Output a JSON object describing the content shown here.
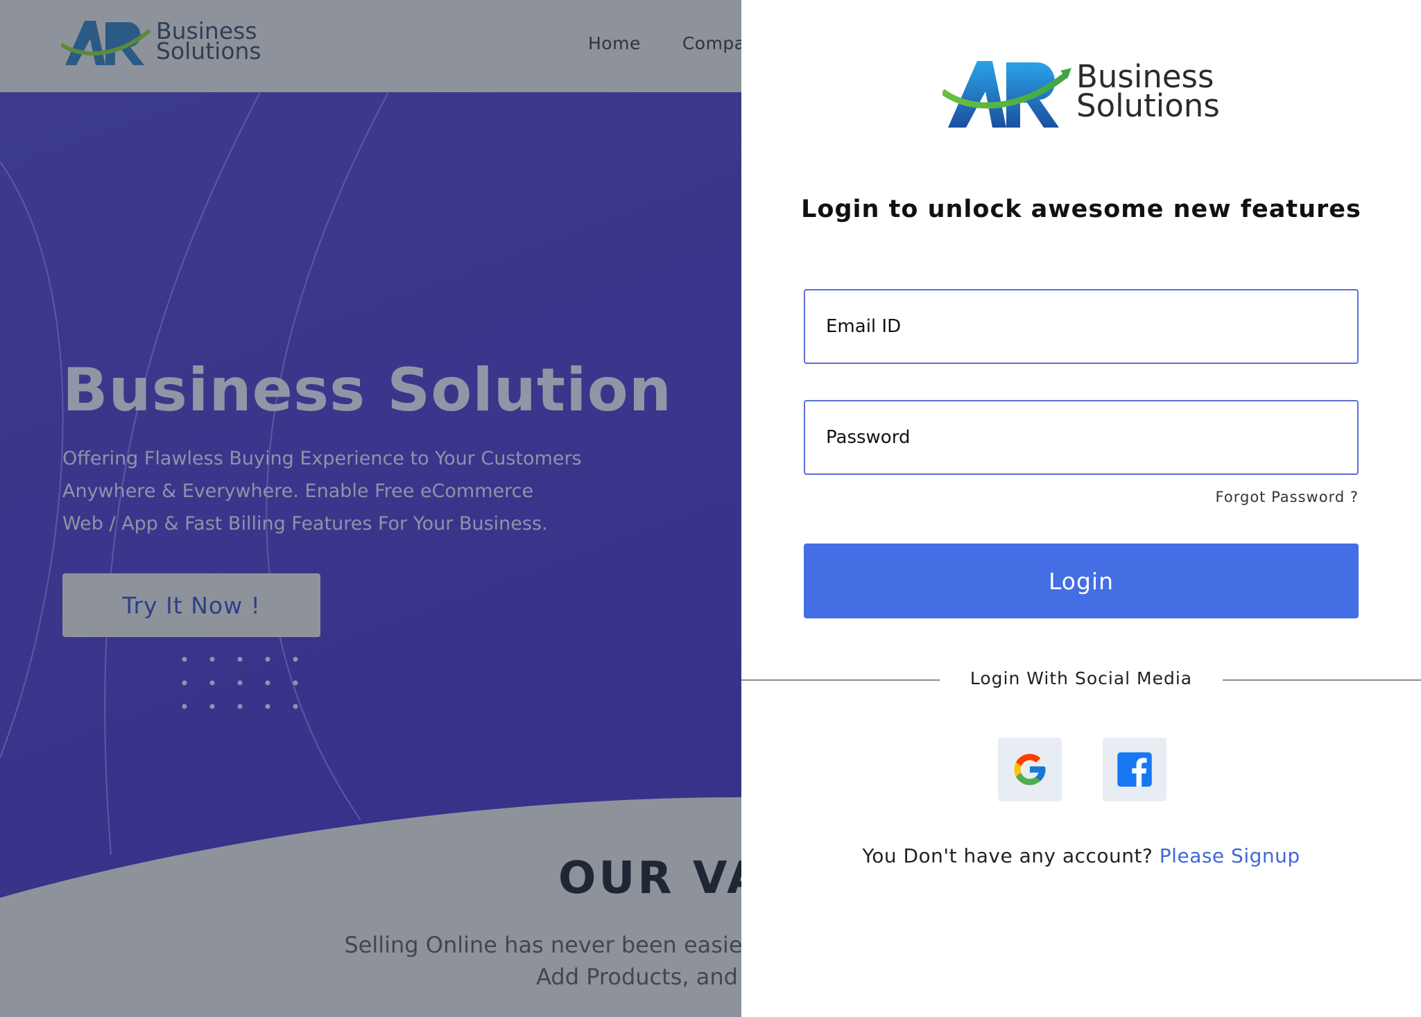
{
  "background": {
    "logo": {
      "line1": "Business",
      "line2": "Solutions"
    },
    "nav": [
      "Home",
      "Compa"
    ],
    "hero": {
      "title": "Business Solution",
      "subtitle_lines": [
        "Offering Flawless Buying Experience to Your Customers",
        "Anywhere & Everywhere. Enable Free eCommerce",
        "Web / App & Fast Billing Features For Your Business."
      ],
      "cta": "Try It Now !"
    },
    "values": {
      "title": "OUR VA",
      "text_lines": [
        "Selling Online has never been easier",
        "Add Products, and St"
      ]
    }
  },
  "panel": {
    "logo": {
      "line1": "Business",
      "line2": "Solutions"
    },
    "title": "Login to unlock awesome new features",
    "email_placeholder": "Email ID",
    "password_placeholder": "Password",
    "forgot": "Forgot Password ?",
    "login_label": "Login",
    "social_label": "Login With Social Media",
    "social": [
      {
        "name": "google",
        "icon": "google-icon"
      },
      {
        "name": "facebook",
        "icon": "facebook-icon"
      }
    ],
    "signup_prompt": "You Don't have any account?",
    "signup_link": "Please Signup"
  },
  "colors": {
    "primary": "#446ee3",
    "link": "#3f67d8",
    "hero_bg": "#3a368b",
    "overlay": "#8e939b"
  }
}
